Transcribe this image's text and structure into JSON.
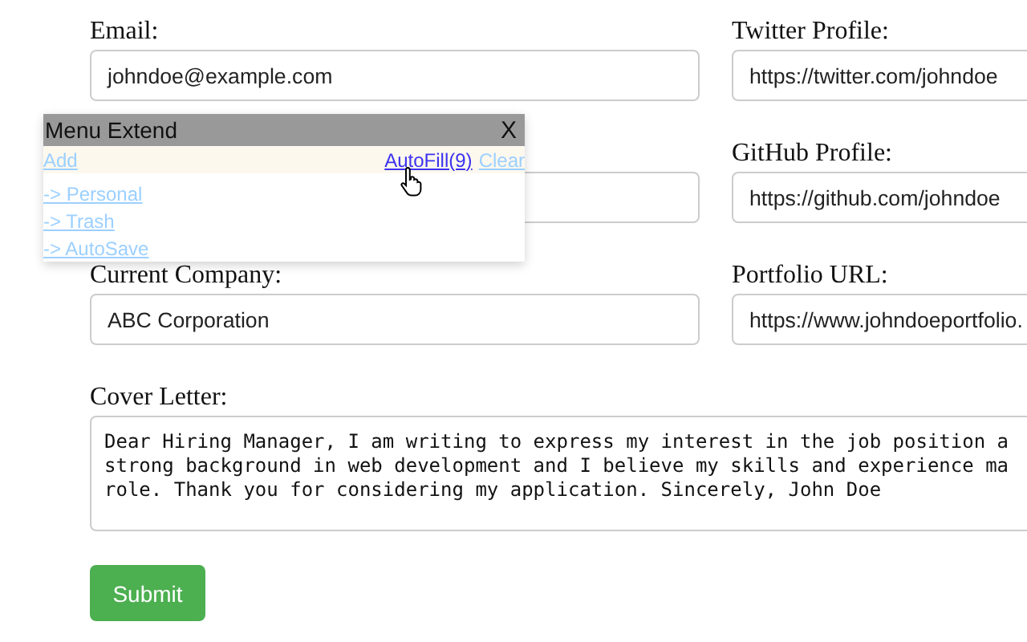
{
  "form": {
    "rows": [
      [
        {
          "label": "Email:",
          "value": "johndoe@example.com"
        },
        {
          "label": "Twitter Profile:",
          "value": "https://twitter.com/johndoe"
        }
      ],
      [
        {},
        {
          "label": "GitHub Profile:",
          "value": "https://github.com/johndoe"
        }
      ],
      [
        {
          "label": "Current Company:",
          "value": "ABC Corporation"
        },
        {
          "label": "Portfolio URL:",
          "value": "https://www.johndoeportfolio."
        }
      ]
    ],
    "cover_letter": {
      "label": "Cover Letter:",
      "value": "Dear Hiring Manager, I am writing to express my interest in the job position a\nstrong background in web development and I believe my skills and experience ma\nrole. Thank you for considering my application. Sincerely, John Doe"
    },
    "submit": "Submit"
  },
  "menu": {
    "title": "Menu Extend",
    "close": "X",
    "actions": [
      {
        "label": "Add",
        "hovered": false
      },
      {
        "label": "AutoFill(9)",
        "hovered": true
      },
      {
        "label": "Clear",
        "hovered": false
      }
    ],
    "links": [
      "-> Personal",
      "-> Trash",
      "-> AutoSave"
    ]
  }
}
